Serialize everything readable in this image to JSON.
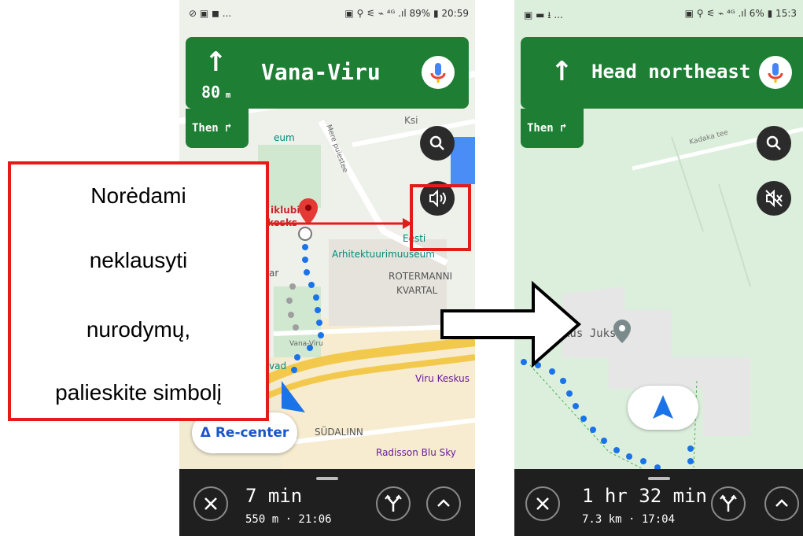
{
  "left_phone": {
    "status": {
      "left": "⊘ ▣ ◼ ...",
      "right": "▣ ⚲ ⚟ ⌁ ⁴ᴳ .ıl 89% ▮ 20:59"
    },
    "nav": {
      "arrow": "↑",
      "distance": "80",
      "distance_unit": "m",
      "street": "Vana-Viru",
      "then": "Then ↱"
    },
    "map_labels": {
      "kiklubi": "iklubi",
      "keskus": "kesks",
      "eesti": "Eesti",
      "museum": "Arhitektuurimuuseum",
      "rotermanni": "ROTERMANNI",
      "kvartal": "KVARTAL",
      "viru_keskus": "Viru Keskus",
      "sudalinn": "SÜDALINN",
      "radisson": "Radisson Blu Sky",
      "eum": "eum",
      "vad": "vad",
      "ar": "ar",
      "ksi": "Ksi",
      "mere": "Mere puiestee",
      "tatari": "Vana-Viru"
    },
    "recenter_label": "Re-center",
    "eta": {
      "time": "7 min",
      "sub": "550 m · 21:06"
    }
  },
  "right_phone": {
    "status": {
      "left": "▣ ▬ ⭳ ...",
      "right": "▣ ⚲ ⚟ ⌁ ⁴ᴳ .ıl 6% ▮ 15:3"
    },
    "nav": {
      "arrow": "↑",
      "instruction": "Head northeast",
      "then": "Then ↱"
    },
    "map_labels": {
      "juks": "kus Juks",
      "kadaka": "Kadaka tee"
    },
    "eta": {
      "time": "1 hr 32 min",
      "sub": "7.3 km · 17:04"
    }
  },
  "callout": {
    "lines": [
      "Norėdami",
      "neklausyti",
      "nurodymų,",
      "palieskite simbolį"
    ]
  },
  "colors": {
    "nav_green": "#1e7e34",
    "accent_red": "#e31b1b",
    "route_blue": "#1a73e8"
  },
  "icons": [
    "search-icon",
    "volume-icon",
    "mute-icon",
    "mic-icon",
    "close-icon",
    "alt-routes-icon",
    "chevron-up-icon",
    "navigation-arrow-icon",
    "location-pin-icon"
  ]
}
